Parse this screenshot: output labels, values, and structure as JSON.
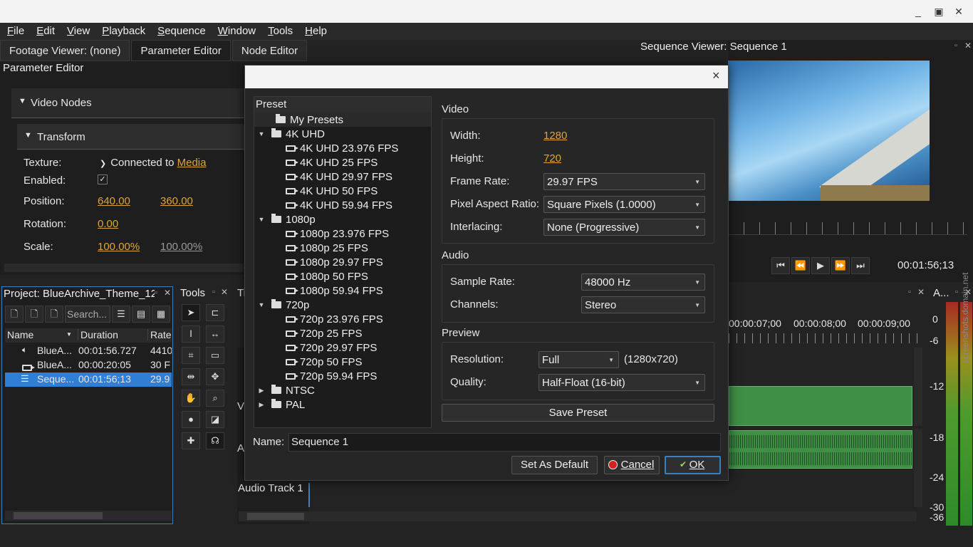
{
  "window": {
    "minimize": "_",
    "maximize": "▣",
    "close": "✕"
  },
  "menu": [
    "File",
    "Edit",
    "View",
    "Playback",
    "Sequence",
    "Window",
    "Tools",
    "Help"
  ],
  "tabs": [
    "Footage Viewer: (none)",
    "Parameter Editor",
    "Node Editor"
  ],
  "param_editor": {
    "title": "Parameter Editor",
    "video_nodes": "Video Nodes",
    "transform": "Transform",
    "texture_label": "Texture:",
    "texture_value": "Connected to",
    "texture_link": "Media",
    "enabled_label": "Enabled:",
    "enabled_check": "✓",
    "position_label": "Position:",
    "position_x": "640.00",
    "position_y": "360.00",
    "rotation_label": "Rotation:",
    "rotation_value": "0.00",
    "scale_label": "Scale:",
    "scale_x": "100.00%",
    "scale_y": "100.00%"
  },
  "project": {
    "title": "Project: BlueArchive_Theme_12",
    "search_placeholder": "Search...",
    "columns": [
      "Name",
      "Duration",
      "Rate"
    ],
    "rows": [
      {
        "name": "BlueA...",
        "duration": "00:01:56.727",
        "rate": "4410"
      },
      {
        "name": "BlueA...",
        "duration": "00:00:20:05",
        "rate": "30 F"
      },
      {
        "name": "Seque...",
        "duration": "00:01:56;13",
        "rate": "29.9"
      }
    ]
  },
  "tools": {
    "title": "Tools"
  },
  "timeline": {
    "title": "Ti",
    "track_v": "V",
    "track_a": "A",
    "audio_track": "Audio Track 1",
    "timecodes": [
      "00:00:07;00",
      "00:00:08;00",
      "00:00:09;00"
    ]
  },
  "viewer": {
    "title": "Sequence Viewer: Sequence 1",
    "timecode": "00:01:56;13"
  },
  "audio_meter": {
    "title": "A...",
    "labels": [
      "0",
      "-6",
      "-12",
      "-18",
      "-24",
      "-30",
      "-36"
    ]
  },
  "dialog": {
    "close": "×",
    "preset_header": "Preset",
    "presets": [
      {
        "type": "folder",
        "label": "My Presets",
        "level": 0,
        "expanded": null
      },
      {
        "type": "folder",
        "label": "4K UHD",
        "level": 0,
        "expanded": true
      },
      {
        "type": "item",
        "label": "4K UHD 23.976 FPS",
        "level": 1
      },
      {
        "type": "item",
        "label": "4K UHD 25 FPS",
        "level": 1
      },
      {
        "type": "item",
        "label": "4K UHD 29.97 FPS",
        "level": 1
      },
      {
        "type": "item",
        "label": "4K UHD 50 FPS",
        "level": 1
      },
      {
        "type": "item",
        "label": "4K UHD 59.94 FPS",
        "level": 1
      },
      {
        "type": "folder",
        "label": "1080p",
        "level": 0,
        "expanded": true
      },
      {
        "type": "item",
        "label": "1080p 23.976 FPS",
        "level": 1
      },
      {
        "type": "item",
        "label": "1080p 25 FPS",
        "level": 1
      },
      {
        "type": "item",
        "label": "1080p 29.97 FPS",
        "level": 1
      },
      {
        "type": "item",
        "label": "1080p 50 FPS",
        "level": 1
      },
      {
        "type": "item",
        "label": "1080p 59.94 FPS",
        "level": 1
      },
      {
        "type": "folder",
        "label": "720p",
        "level": 0,
        "expanded": true
      },
      {
        "type": "item",
        "label": "720p 23.976 FPS",
        "level": 1
      },
      {
        "type": "item",
        "label": "720p 25 FPS",
        "level": 1
      },
      {
        "type": "item",
        "label": "720p 29.97 FPS",
        "level": 1
      },
      {
        "type": "item",
        "label": "720p 50 FPS",
        "level": 1
      },
      {
        "type": "item",
        "label": "720p 59.94 FPS",
        "level": 1
      },
      {
        "type": "folder",
        "label": "NTSC",
        "level": 0,
        "expanded": false
      },
      {
        "type": "folder",
        "label": "PAL",
        "level": 0,
        "expanded": false
      }
    ],
    "video": {
      "title": "Video",
      "width_label": "Width:",
      "width": "1280",
      "height_label": "Height:",
      "height": "720",
      "framerate_label": "Frame Rate:",
      "framerate": "29.97 FPS",
      "par_label": "Pixel Aspect Ratio:",
      "par": "Square Pixels (1.0000)",
      "interlacing_label": "Interlacing:",
      "interlacing": "None (Progressive)"
    },
    "audio": {
      "title": "Audio",
      "samplerate_label": "Sample Rate:",
      "samplerate": "48000 Hz",
      "channels_label": "Channels:",
      "channels": "Stereo"
    },
    "preview": {
      "title": "Preview",
      "resolution_label": "Resolution:",
      "resolution": "Full",
      "resolution_dims": "(1280x720)",
      "quality_label": "Quality:",
      "quality": "Half-Float (16-bit)"
    },
    "save_preset": "Save Preset",
    "name_label": "Name:",
    "name_value": "Sequence 1",
    "set_default": "Set As Default",
    "cancel": "Cancel",
    "ok": "OK"
  },
  "colors": {
    "accent": "#e0a33a",
    "selection": "#2f7fd6",
    "clip_green": "#3f8f45"
  },
  "watermark": "screenshots.domain.net"
}
